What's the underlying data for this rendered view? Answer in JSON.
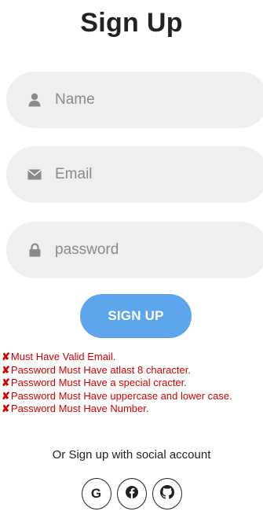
{
  "title": "Sign Up",
  "fields": {
    "name": {
      "placeholder": "Name",
      "icon": "user-icon"
    },
    "email": {
      "placeholder": "Email",
      "icon": "envelope-icon"
    },
    "password": {
      "placeholder": "password",
      "icon": "lock-icon"
    }
  },
  "signup_button": "SIGN UP",
  "errors": [
    "Must Have Valid Email.",
    "Password Must Have atlast 8 character.",
    "Password Must Have a special cracter.",
    "Password Must Have uppercase and lower case.",
    "Password Must Have Number."
  ],
  "social": {
    "prompt": "Or Sign up with social account",
    "providers": [
      {
        "name": "google",
        "icon": "google-icon",
        "glyph": "G"
      },
      {
        "name": "facebook",
        "icon": "facebook-icon"
      },
      {
        "name": "github",
        "icon": "github-icon"
      }
    ]
  },
  "colors": {
    "button": "#5ea6ec",
    "field_bg": "#efefef",
    "error": "#d40000",
    "icon": "#8a8a8a"
  }
}
